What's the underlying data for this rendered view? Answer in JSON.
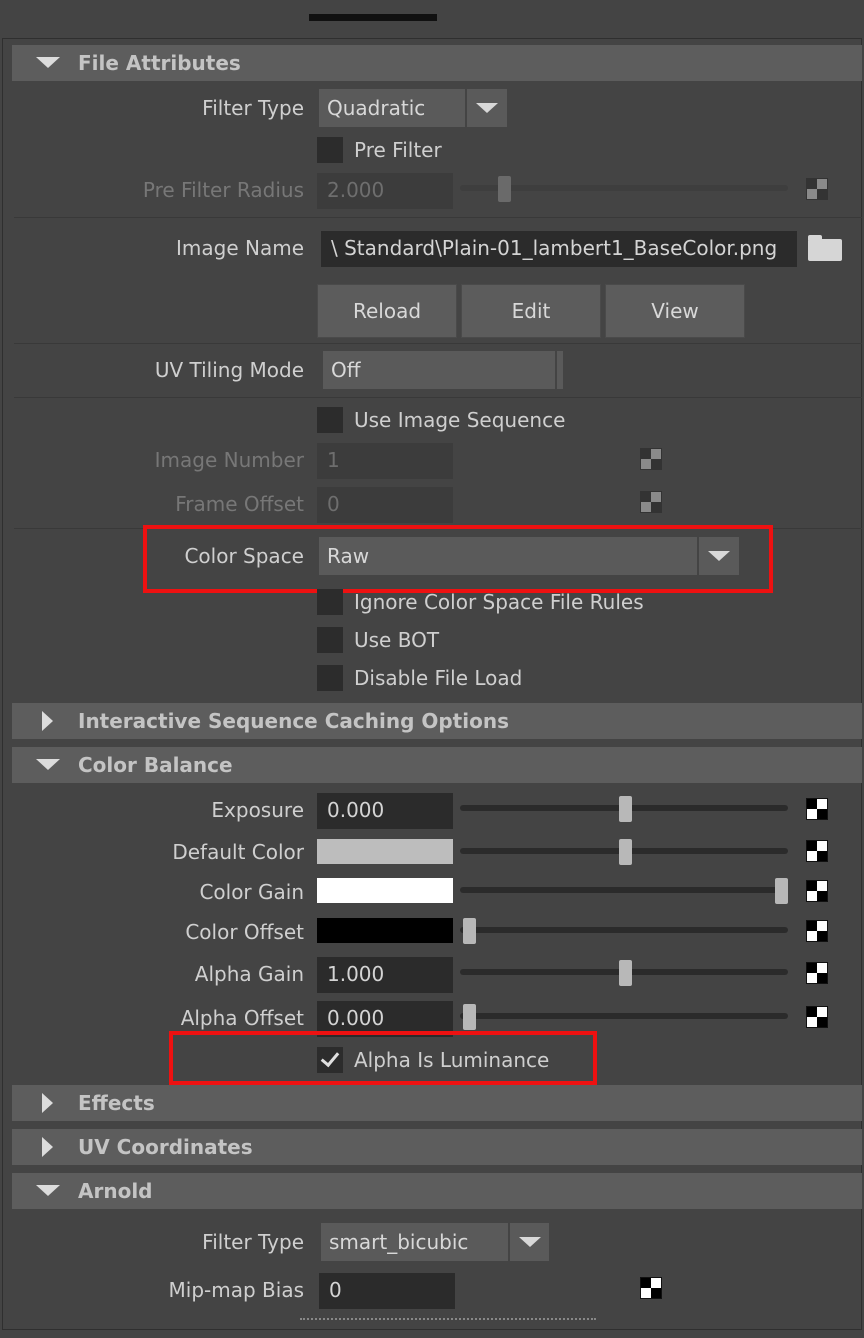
{
  "sections": {
    "file_attributes": "File Attributes",
    "interactive_caching": "Interactive Sequence Caching Options",
    "color_balance": "Color Balance",
    "effects": "Effects",
    "uv_coordinates": "UV Coordinates",
    "arnold": "Arnold"
  },
  "file": {
    "filter_type_label": "Filter Type",
    "filter_type_value": "Quadratic",
    "pre_filter_label": "Pre Filter",
    "pre_filter_radius_label": "Pre Filter Radius",
    "pre_filter_radius_value": "2.000",
    "image_name_label": "Image Name",
    "image_name_value": "\\ Standard\\Plain-01_lambert1_BaseColor.png",
    "reload_label": "Reload",
    "edit_label": "Edit",
    "view_label": "View",
    "uv_tiling_label": "UV Tiling Mode",
    "uv_tiling_value": "Off",
    "use_image_sequence_label": "Use Image Sequence",
    "image_number_label": "Image Number",
    "image_number_value": "1",
    "frame_offset_label": "Frame Offset",
    "frame_offset_value": "0",
    "color_space_label": "Color Space",
    "color_space_value": "Raw",
    "ignore_rules_label": "Ignore Color Space File Rules",
    "use_bot_label": "Use BOT",
    "disable_file_load_label": "Disable File Load"
  },
  "color_balance": {
    "exposure_label": "Exposure",
    "exposure_value": "0.000",
    "default_color_label": "Default Color",
    "color_gain_label": "Color Gain",
    "color_offset_label": "Color Offset",
    "alpha_gain_label": "Alpha Gain",
    "alpha_gain_value": "1.000",
    "alpha_offset_label": "Alpha Offset",
    "alpha_offset_value": "0.000",
    "alpha_is_luminance_label": "Alpha Is Luminance",
    "alpha_is_luminance_checked": true,
    "default_color_hex": "#bdbdbd",
    "color_gain_hex": "#ffffff",
    "color_offset_hex": "#000000"
  },
  "arnold": {
    "filter_type_label": "Filter Type",
    "filter_type_value": "smart_bicubic",
    "mipmap_bias_label": "Mip-map Bias",
    "mipmap_bias_value": "0"
  },
  "highlight_color": "#ee1111"
}
